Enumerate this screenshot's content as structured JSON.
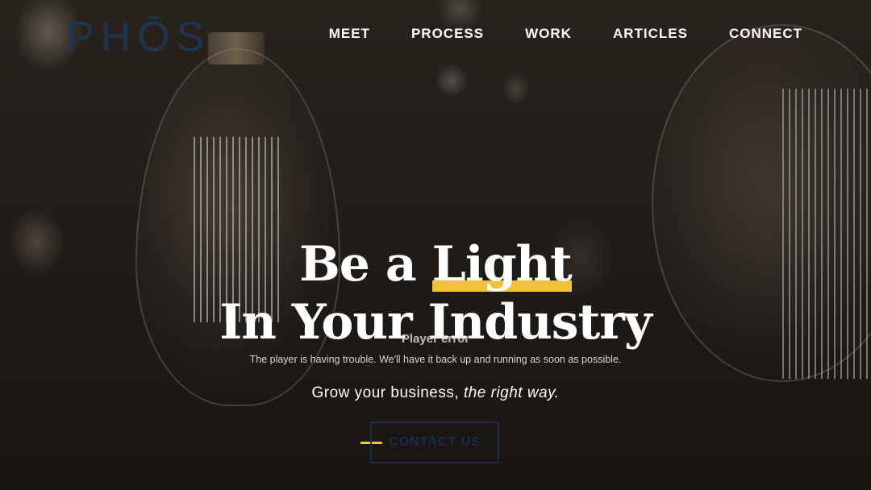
{
  "brand": {
    "logo_text": "PHŌS",
    "accent_color": "#f2c23a",
    "logo_color": "#1e3550"
  },
  "nav": {
    "items": [
      {
        "label": "MEET"
      },
      {
        "label": "PROCESS"
      },
      {
        "label": "WORK"
      },
      {
        "label": "ARTICLES"
      },
      {
        "label": "CONNECT"
      }
    ]
  },
  "hero": {
    "title_line1_prefix": "Be a",
    "title_line1_highlight": "Light",
    "title_line2": "In Your Industry",
    "tagline_prefix": "Grow your business,",
    "tagline_emphasis": "the right way.",
    "cta_label": "CONTACT US"
  },
  "player_error": {
    "title": "Player error",
    "message": "The player is having trouble. We'll have it back up and running as soon as possible."
  }
}
